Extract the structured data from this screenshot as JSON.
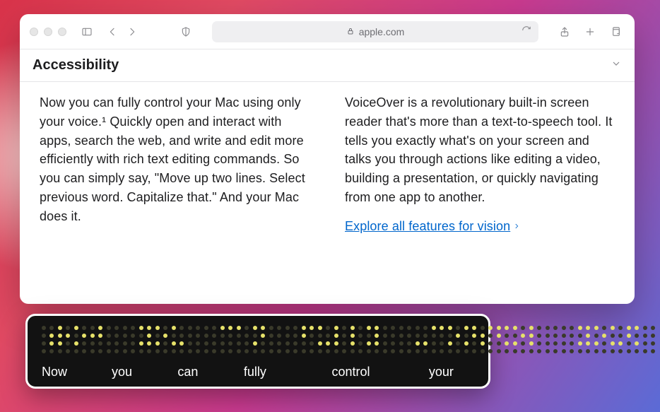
{
  "address": {
    "domain": "apple.com"
  },
  "section": {
    "title": "Accessibility"
  },
  "content": {
    "left": "Now you can fully control your Mac using only your voice.¹ Quickly open and interact with apps, search the web, and write and edit more efficiently with rich text editing commands. So you can simply say, \"Move up two lines. Select previous word. Capitalize that.\" And your Mac does it.",
    "right": "VoiceOver is a revolutionary built-in screen reader that's more than a text-to-speech tool. It tells you exactly what's on your screen and talks you through actions like editing a video, building a presentation, or quickly navigating from one app to another.",
    "link": "Explore all features for vision"
  },
  "braille": {
    "cells": [
      [
        0,
        0,
        0,
        1,
        0,
        1,
        0,
        0
      ],
      [
        1,
        0,
        1,
        1,
        1,
        0,
        0,
        0
      ],
      [
        1,
        0,
        0,
        1,
        1,
        0,
        0,
        0
      ],
      [
        0,
        1,
        1,
        1,
        0,
        0,
        0,
        0
      ],
      [
        0,
        0,
        0,
        0,
        0,
        0,
        0,
        0
      ],
      [
        0,
        0,
        0,
        0,
        0,
        0,
        0,
        0
      ],
      [
        1,
        1,
        0,
        1,
        1,
        1,
        0,
        0
      ],
      [
        1,
        0,
        0,
        1,
        1,
        0,
        0,
        0
      ],
      [
        1,
        0,
        0,
        0,
        1,
        1,
        0,
        0
      ],
      [
        0,
        0,
        0,
        0,
        0,
        0,
        0,
        0
      ],
      [
        0,
        0,
        0,
        0,
        0,
        0,
        0,
        0
      ],
      [
        1,
        1,
        0,
        0,
        0,
        0,
        0,
        0
      ],
      [
        1,
        0,
        0,
        0,
        0,
        0,
        0,
        0
      ],
      [
        1,
        1,
        0,
        1,
        1,
        0,
        0,
        0
      ],
      [
        0,
        0,
        0,
        0,
        0,
        0,
        0,
        0
      ],
      [
        0,
        0,
        0,
        0,
        0,
        0,
        0,
        0
      ],
      [
        1,
        1,
        1,
        0,
        0,
        0,
        0,
        0
      ],
      [
        1,
        0,
        0,
        0,
        1,
        1,
        0,
        0
      ],
      [
        1,
        0,
        1,
        0,
        1,
        0,
        0,
        0
      ],
      [
        1,
        0,
        1,
        0,
        1,
        0,
        0,
        0
      ],
      [
        1,
        1,
        0,
        1,
        1,
        1,
        0,
        0
      ],
      [
        0,
        0,
        0,
        0,
        0,
        0,
        0,
        0
      ],
      [
        0,
        0,
        0,
        0,
        0,
        0,
        0,
        0
      ],
      [
        0,
        0,
        0,
        0,
        1,
        1,
        0,
        0
      ],
      [
        1,
        1,
        0,
        0,
        0,
        0,
        0,
        0
      ],
      [
        1,
        0,
        0,
        1,
        1,
        0,
        0,
        0
      ],
      [
        1,
        1,
        0,
        1,
        1,
        0,
        0,
        0
      ],
      [
        0,
        1,
        1,
        0,
        1,
        0,
        0,
        0
      ],
      [
        1,
        1,
        1,
        0,
        0,
        1,
        0,
        0
      ],
      [
        1,
        0,
        0,
        1,
        1,
        0,
        0,
        0
      ],
      [
        1,
        0,
        1,
        0,
        1,
        0,
        0,
        0
      ],
      [
        0,
        0,
        0,
        0,
        0,
        0,
        0,
        0
      ],
      [
        0,
        0,
        0,
        0,
        0,
        0,
        0,
        0
      ],
      [
        1,
        1,
        0,
        1,
        1,
        1,
        0,
        0
      ],
      [
        1,
        0,
        0,
        1,
        1,
        0,
        0,
        0
      ],
      [
        1,
        0,
        0,
        0,
        1,
        1,
        0,
        0
      ],
      [
        1,
        1,
        1,
        0,
        0,
        1,
        0,
        0
      ],
      [
        0,
        0,
        0,
        0,
        0,
        0,
        0,
        0
      ]
    ],
    "words": [
      "Now",
      "you",
      "can",
      "fully",
      "control",
      "your"
    ],
    "word_widths": [
      108,
      102,
      102,
      136,
      150,
      70
    ]
  }
}
